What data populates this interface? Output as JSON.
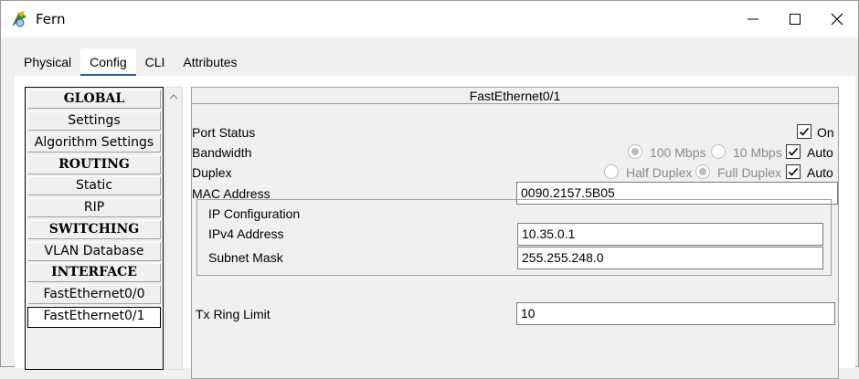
{
  "window": {
    "title": "Fern"
  },
  "tabs": [
    {
      "label": "Physical"
    },
    {
      "label": "Config"
    },
    {
      "label": "CLI"
    },
    {
      "label": "Attributes"
    }
  ],
  "sidebar": {
    "items": [
      {
        "label": "GLOBAL",
        "type": "header"
      },
      {
        "label": "Settings",
        "type": "item"
      },
      {
        "label": "Algorithm Settings",
        "type": "item"
      },
      {
        "label": "ROUTING",
        "type": "header"
      },
      {
        "label": "Static",
        "type": "item"
      },
      {
        "label": "RIP",
        "type": "item"
      },
      {
        "label": "SWITCHING",
        "type": "header"
      },
      {
        "label": "VLAN Database",
        "type": "item"
      },
      {
        "label": "INTERFACE",
        "type": "header"
      },
      {
        "label": "FastEthernet0/0",
        "type": "item"
      },
      {
        "label": "FastEthernet0/1",
        "type": "item",
        "selected": true
      }
    ]
  },
  "panel": {
    "title": "FastEthernet0/1",
    "port_status": {
      "label": "Port Status",
      "on_label": "On",
      "checked": true
    },
    "bandwidth": {
      "label": "Bandwidth",
      "opt1": "100 Mbps",
      "opt2": "10 Mbps",
      "auto_label": "Auto",
      "auto_checked": true
    },
    "duplex": {
      "label": "Duplex",
      "opt1": "Half Duplex",
      "opt2": "Full Duplex",
      "auto_label": "Auto",
      "auto_checked": true
    },
    "mac": {
      "label": "MAC Address",
      "value": "0090.2157.5B05"
    },
    "ip_config": {
      "label": "IP Configuration",
      "ipv4_label": "IPv4 Address",
      "ipv4_value": "10.35.0.1",
      "mask_label": "Subnet Mask",
      "mask_value": "255.255.248.0"
    },
    "tx_ring": {
      "label": "Tx Ring Limit",
      "value": "10"
    }
  }
}
